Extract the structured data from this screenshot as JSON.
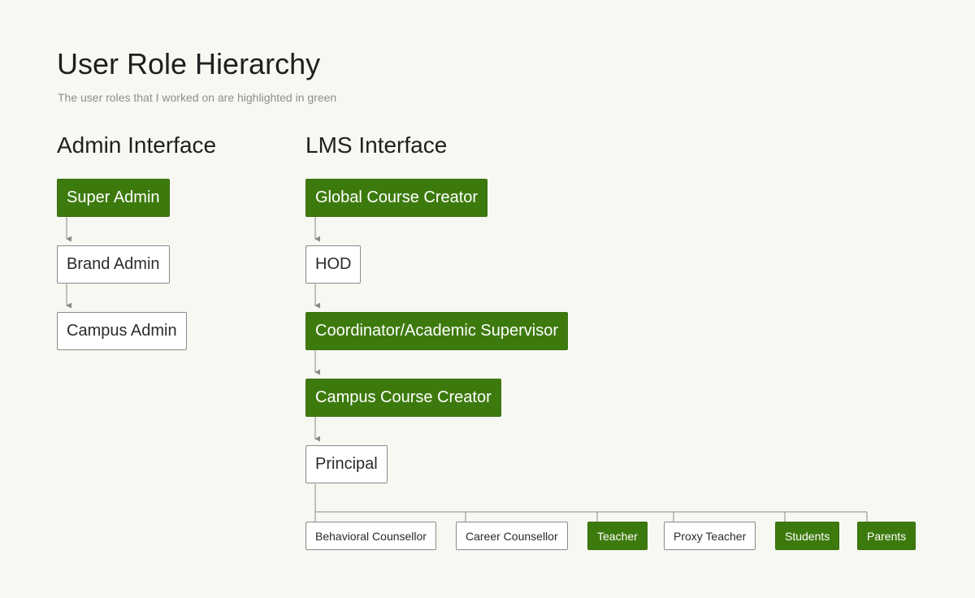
{
  "header": {
    "title": "User Role Hierarchy",
    "subtitle": "The user roles that I worked on are highlighted in green"
  },
  "colors": {
    "highlight": "#3d7a0e",
    "background": "#f6f8f1",
    "connector": "#8a8a8a"
  },
  "admin": {
    "heading": "Admin Interface",
    "roles": [
      {
        "label": "Super Admin",
        "highlighted": true
      },
      {
        "label": "Brand Admin",
        "highlighted": false
      },
      {
        "label": "Campus Admin",
        "highlighted": false
      }
    ]
  },
  "lms": {
    "heading": "LMS Interface",
    "roles": [
      {
        "label": "Global Course Creator",
        "highlighted": true
      },
      {
        "label": "HOD",
        "highlighted": false
      },
      {
        "label": "Coordinator/Academic Supervisor",
        "highlighted": true
      },
      {
        "label": "Campus Course Creator",
        "highlighted": true
      },
      {
        "label": "Principal",
        "highlighted": false
      }
    ],
    "principal_reports": [
      {
        "label": "Behavioral Counsellor",
        "highlighted": false
      },
      {
        "label": "Career Counsellor",
        "highlighted": false
      },
      {
        "label": "Teacher",
        "highlighted": true
      },
      {
        "label": "Proxy Teacher",
        "highlighted": false
      },
      {
        "label": "Students",
        "highlighted": true
      },
      {
        "label": "Parents",
        "highlighted": true
      }
    ]
  }
}
